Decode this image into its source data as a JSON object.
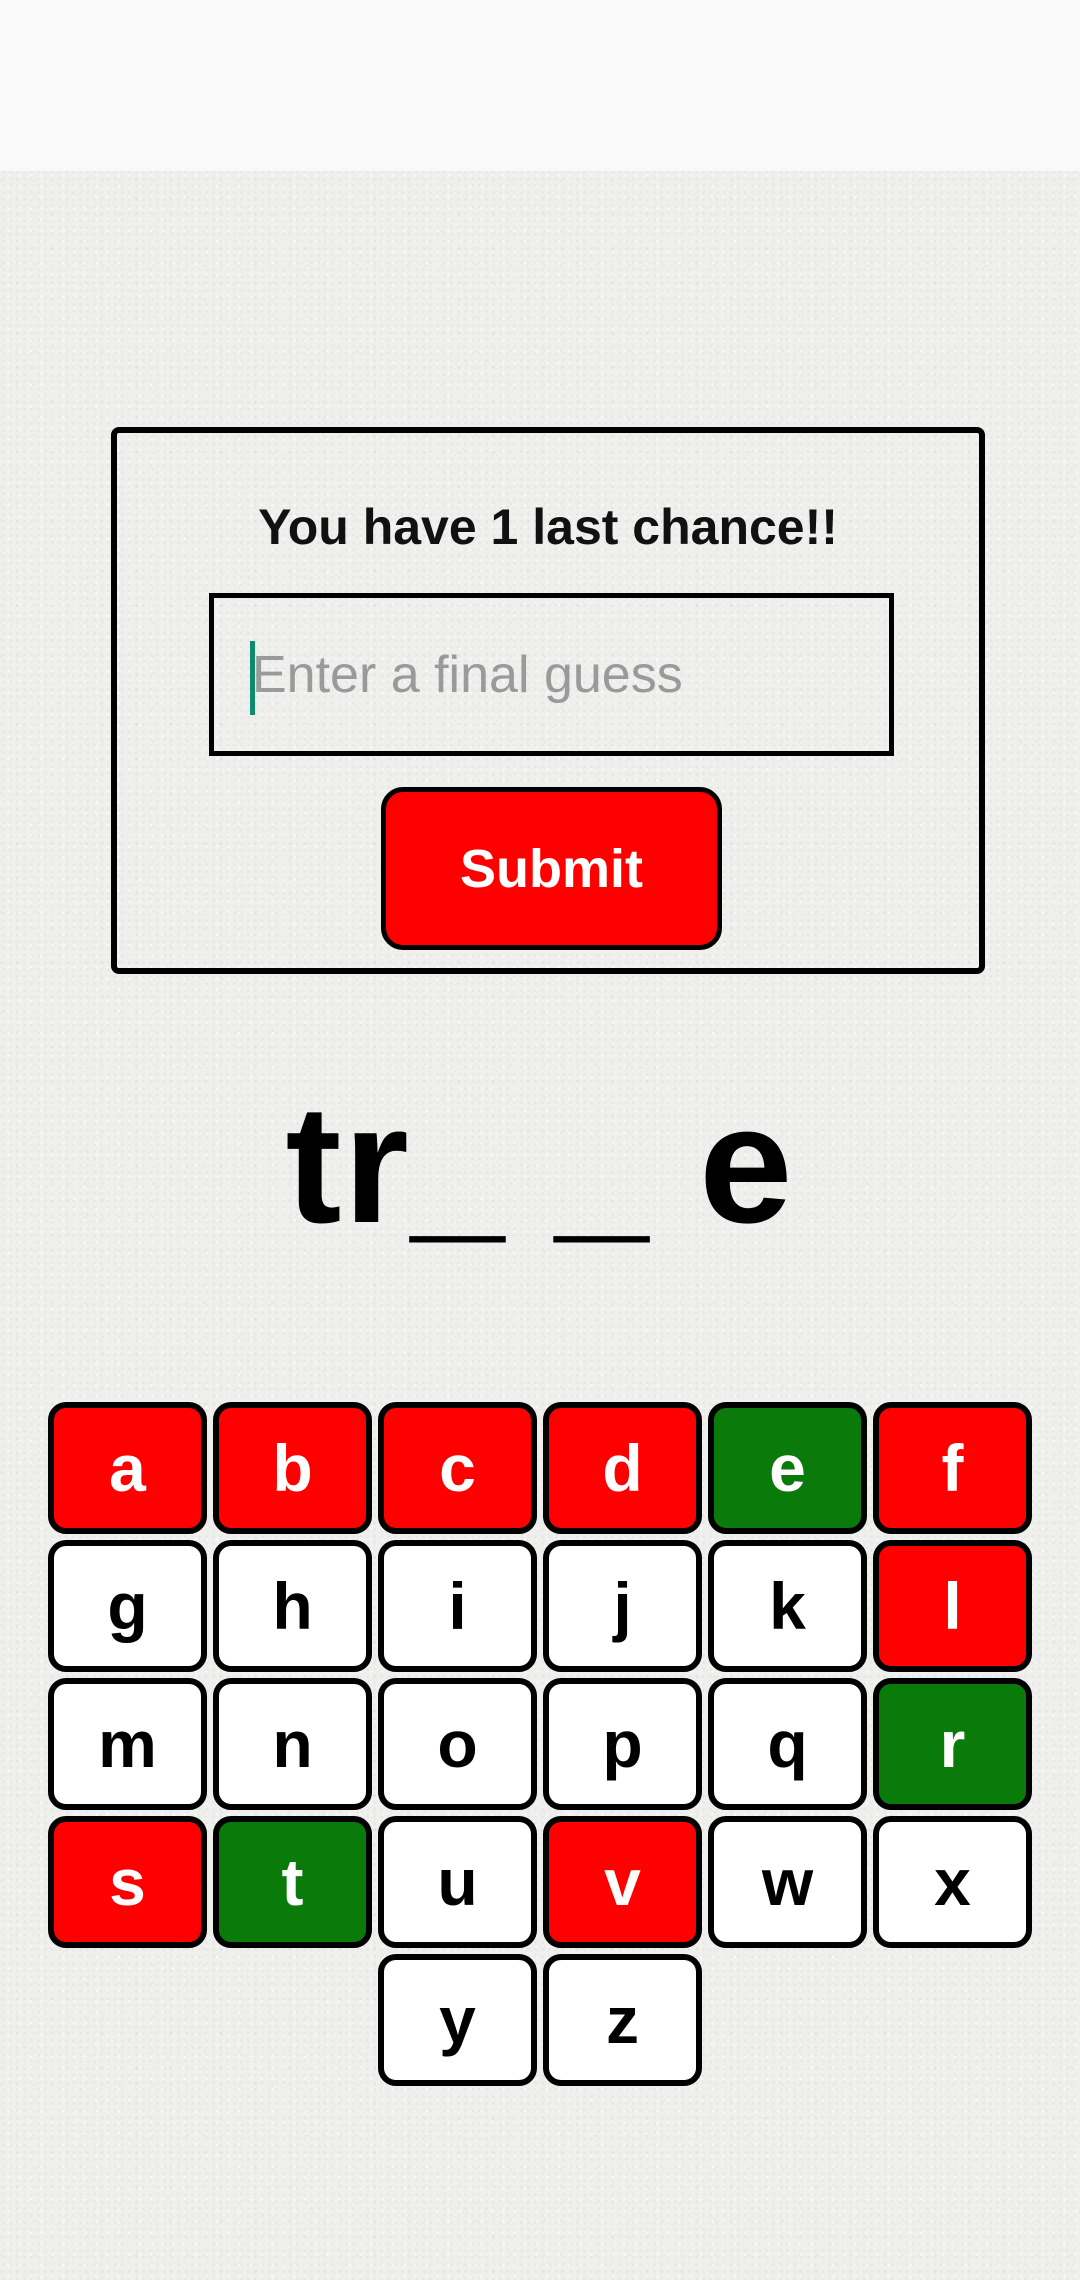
{
  "dialog": {
    "title": "You have 1 last chance!!",
    "input_placeholder": "Enter a final guess",
    "input_value": "",
    "submit_label": "Submit"
  },
  "word_display": "tr_ _ e",
  "colors": {
    "wrong": "#ff0000",
    "correct": "#0a7a0a",
    "unused": "#ffffff"
  },
  "keyboard": {
    "rows": [
      [
        {
          "letter": "a",
          "state": "wrong"
        },
        {
          "letter": "b",
          "state": "wrong"
        },
        {
          "letter": "c",
          "state": "wrong"
        },
        {
          "letter": "d",
          "state": "wrong"
        },
        {
          "letter": "e",
          "state": "correct"
        },
        {
          "letter": "f",
          "state": "wrong"
        }
      ],
      [
        {
          "letter": "g",
          "state": "unused"
        },
        {
          "letter": "h",
          "state": "unused"
        },
        {
          "letter": "i",
          "state": "unused"
        },
        {
          "letter": "j",
          "state": "unused"
        },
        {
          "letter": "k",
          "state": "unused"
        },
        {
          "letter": "l",
          "state": "wrong"
        }
      ],
      [
        {
          "letter": "m",
          "state": "unused"
        },
        {
          "letter": "n",
          "state": "unused"
        },
        {
          "letter": "o",
          "state": "unused"
        },
        {
          "letter": "p",
          "state": "unused"
        },
        {
          "letter": "q",
          "state": "unused"
        },
        {
          "letter": "r",
          "state": "correct"
        }
      ],
      [
        {
          "letter": "s",
          "state": "wrong"
        },
        {
          "letter": "t",
          "state": "correct"
        },
        {
          "letter": "u",
          "state": "unused"
        },
        {
          "letter": "v",
          "state": "wrong"
        },
        {
          "letter": "w",
          "state": "unused"
        },
        {
          "letter": "x",
          "state": "unused"
        }
      ],
      [
        {
          "letter": "y",
          "state": "unused"
        },
        {
          "letter": "z",
          "state": "unused"
        }
      ]
    ]
  }
}
